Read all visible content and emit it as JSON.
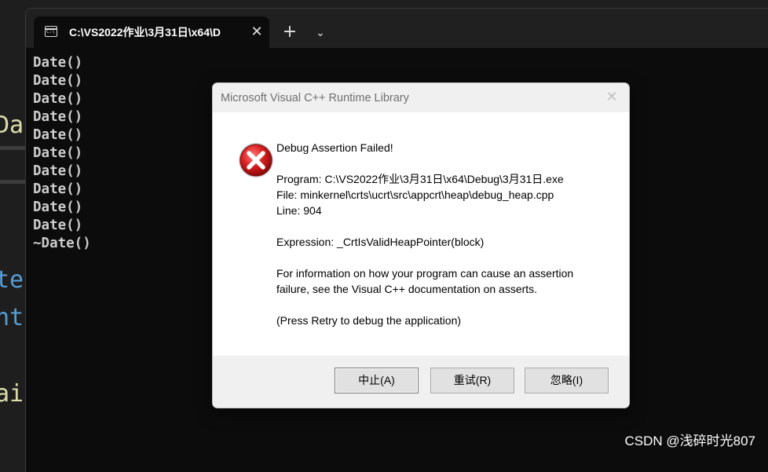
{
  "editor": {
    "fragments": [
      "Da",
      "te",
      "nt",
      "ai"
    ]
  },
  "terminal": {
    "tab_title": "C:\\VS2022作业\\3月31日\\x64\\D",
    "tab_icon_text": "C:\\",
    "close_label": "✕",
    "new_tab_label": "+",
    "dropdown_label": "⌄",
    "output": [
      "Date()",
      "Date()",
      "Date()",
      "Date()",
      "Date()",
      "Date()",
      "Date()",
      "Date()",
      "Date()",
      "Date()",
      "~Date()"
    ]
  },
  "dialog": {
    "title": "Microsoft Visual C++ Runtime Library",
    "close_label": "✕",
    "heading": "Debug Assertion Failed!",
    "program": "Program: C:\\VS2022作业\\3月31日\\x64\\Debug\\3月31日.exe",
    "file": "File: minkernel\\crts\\ucrt\\src\\appcrt\\heap\\debug_heap.cpp",
    "line": "Line: 904",
    "expression": "Expression: _CrtIsValidHeapPointer(block)",
    "info_1": "For information on how your program can cause an assertion",
    "info_2": "failure, see the Visual C++ documentation on asserts.",
    "hint": "(Press Retry to debug the application)",
    "buttons": {
      "abort": "中止(A)",
      "retry": "重试(R)",
      "ignore": "忽略(I)"
    }
  },
  "watermark": "CSDN @浅碎时光807",
  "colors": {
    "editor_yellow": "#dcdcaa",
    "editor_blue": "#569cd6",
    "error_red": "#d81e1e"
  }
}
